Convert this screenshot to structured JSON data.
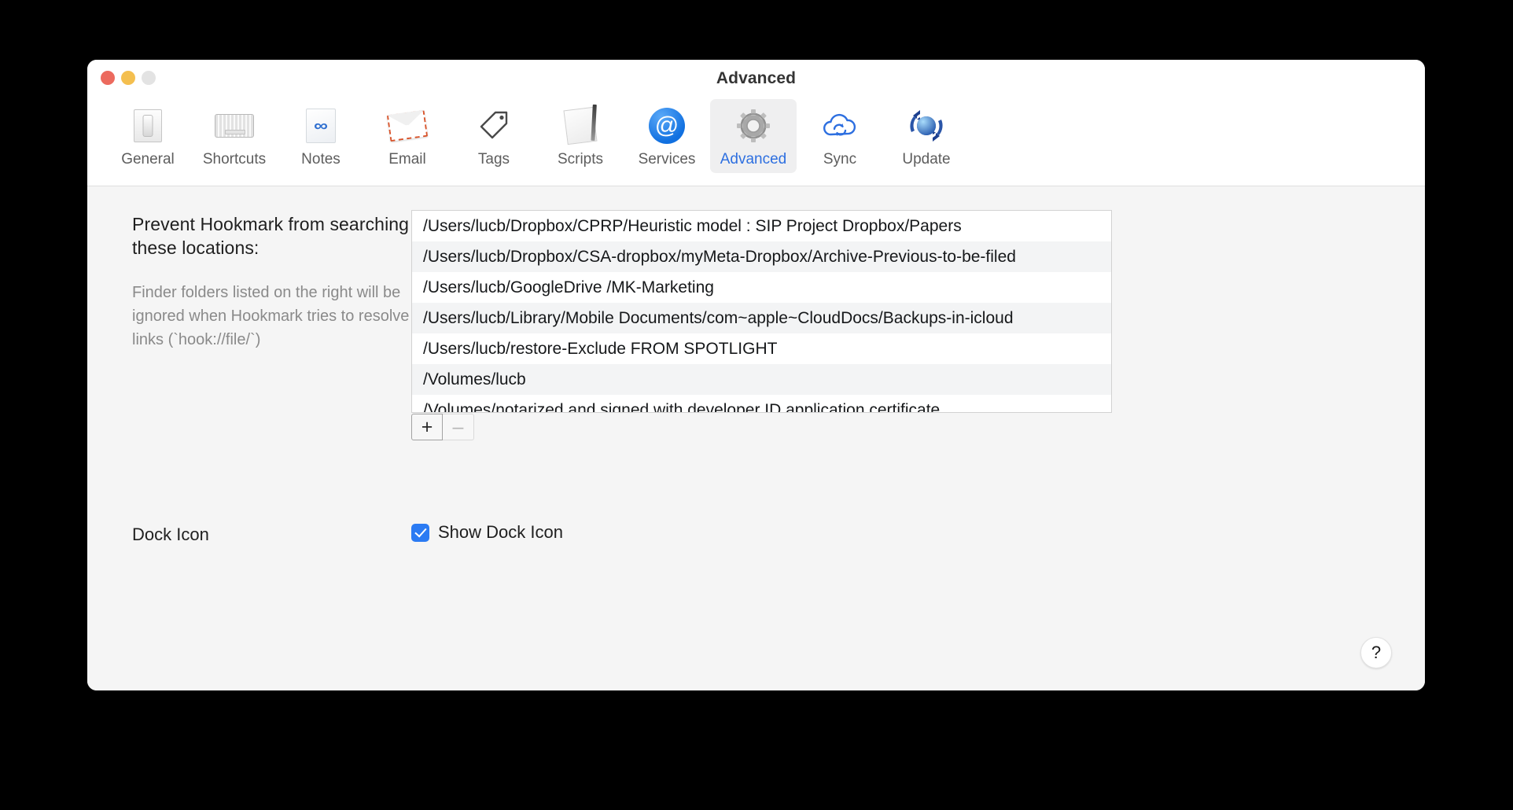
{
  "window": {
    "title": "Advanced",
    "traffic_lights": [
      {
        "name": "close",
        "color": "#ec6a5e"
      },
      {
        "name": "minimize",
        "color": "#f4bf4f"
      },
      {
        "name": "zoom",
        "color": "#e3e3e3"
      }
    ]
  },
  "toolbar": {
    "selected": "Advanced",
    "accent_color": "#2d6fe0",
    "tabs": [
      {
        "label": "General",
        "icon": "toggle-switch-icon"
      },
      {
        "label": "Shortcuts",
        "icon": "keyboard-icon"
      },
      {
        "label": "Notes",
        "icon": "infinity-document-icon"
      },
      {
        "label": "Email",
        "icon": "envelope-icon"
      },
      {
        "label": "Tags",
        "icon": "tag-icon"
      },
      {
        "label": "Scripts",
        "icon": "notepad-pencil-icon"
      },
      {
        "label": "Services",
        "icon": "at-sign-circle-icon"
      },
      {
        "label": "Advanced",
        "icon": "gear-icon"
      },
      {
        "label": "Sync",
        "icon": "cloud-sync-icon"
      },
      {
        "label": "Update",
        "icon": "globe-refresh-icon"
      }
    ]
  },
  "main": {
    "prevent_label": "Prevent Hookmark from searching these locations:",
    "prevent_description": "Finder folders listed on the right will be ignored when Hookmark tries to resolve file links (`hook://file/`)",
    "excluded_locations": [
      "/Users/lucb/Dropbox/CPRP/Heuristic model : SIP Project Dropbox/Papers",
      "/Users/lucb/Dropbox/CSA-dropbox/myMeta-Dropbox/Archive-Previous-to-be-filed",
      "/Users/lucb/GoogleDrive /MK-Marketing",
      "/Users/lucb/Library/Mobile Documents/com~apple~CloudDocs/Backups-in-icloud",
      "/Users/lucb/restore-Exclude FROM SPOTLIGHT",
      "/Volumes/lucb",
      "/Volumes/notarized and signed with developer ID application certificate"
    ],
    "add_button_label": "+",
    "remove_button_label": "–",
    "dock_icon_label": "Dock Icon",
    "show_dock_icon_label": "Show Dock Icon",
    "show_dock_icon_checked": true,
    "help_button_label": "?"
  }
}
